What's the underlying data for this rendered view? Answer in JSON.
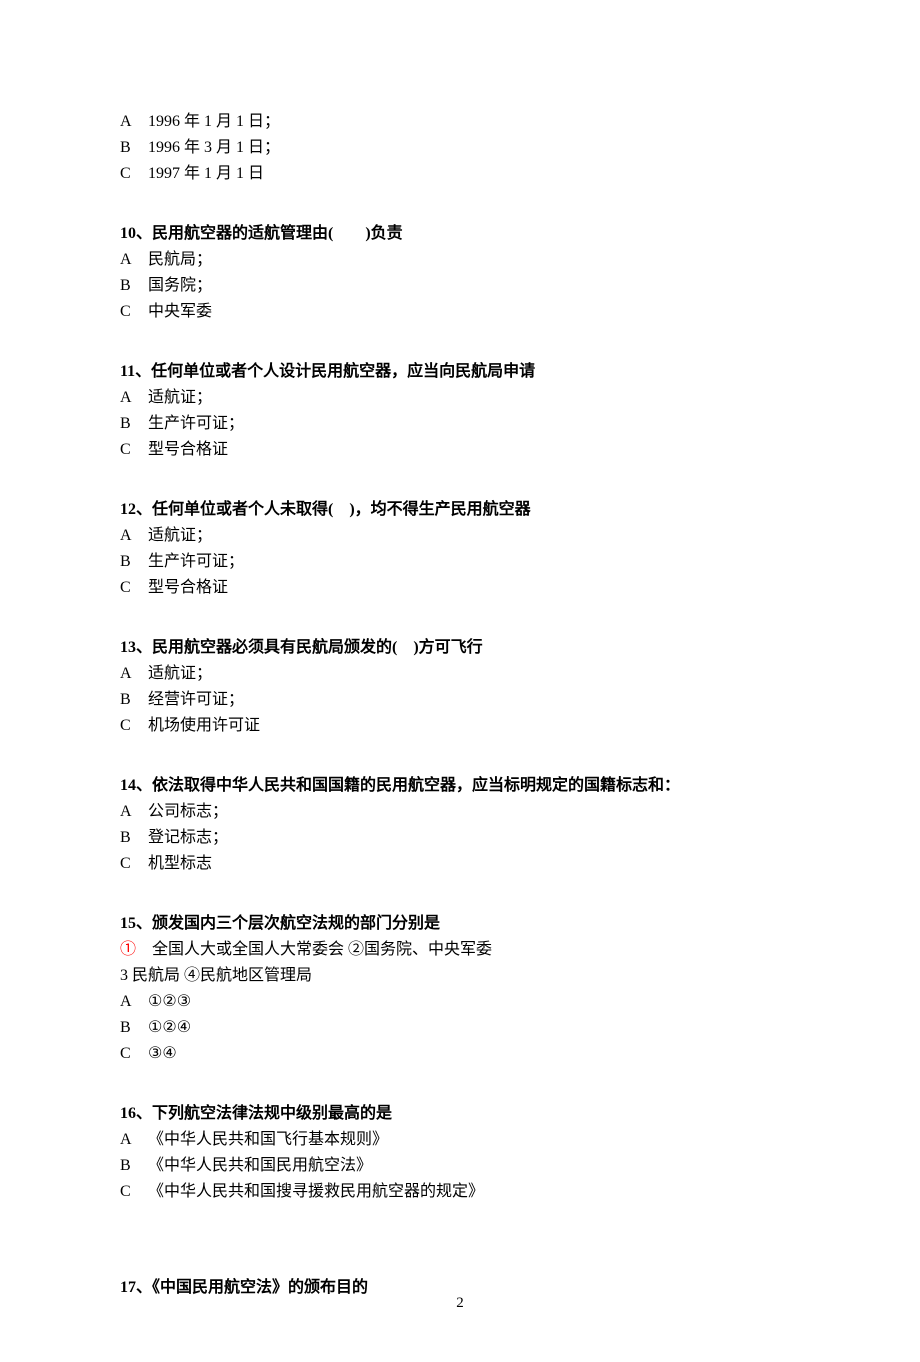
{
  "q9_options": [
    {
      "label": "A",
      "text": "1996 年 1 月 1 日；"
    },
    {
      "label": "B",
      "text": "1996 年 3 月 1 日；"
    },
    {
      "label": "C",
      "text": "1997 年 1 月 1 日"
    }
  ],
  "q10": {
    "stem": "10、民用航空器的适航管理由(　　)负责",
    "options": [
      {
        "label": "A",
        "text": "民航局；"
      },
      {
        "label": "B",
        "text": "国务院；"
      },
      {
        "label": "C",
        "text": "中央军委"
      }
    ]
  },
  "q11": {
    "stem": "11、任何单位或者个人设计民用航空器，应当向民航局申请",
    "options": [
      {
        "label": "A",
        "text": "适航证；"
      },
      {
        "label": "B",
        "text": "生产许可证；"
      },
      {
        "label": "C",
        "text": "型号合格证"
      }
    ]
  },
  "q12": {
    "stem": "12、任何单位或者个人未取得(　)，均不得生产民用航空器",
    "options": [
      {
        "label": "A",
        "text": "适航证；"
      },
      {
        "label": "B",
        "text": "生产许可证；"
      },
      {
        "label": "C",
        "text": "型号合格证"
      }
    ]
  },
  "q13": {
    "stem": "13、民用航空器必须具有民航局颁发的(　)方可飞行",
    "options": [
      {
        "label": "A",
        "text": "适航证；"
      },
      {
        "label": "B",
        "text": "经营许可证；"
      },
      {
        "label": "C",
        "text": "机场使用许可证"
      }
    ]
  },
  "q14": {
    "stem": "14、依法取得中华人民共和国国籍的民用航空器，应当标明规定的国籍标志和：",
    "options": [
      {
        "label": "A",
        "text": "公司标志；"
      },
      {
        "label": "B",
        "text": "登记标志；"
      },
      {
        "label": "C",
        "text": "机型标志"
      }
    ]
  },
  "q15": {
    "stem": "15、颁发国内三个层次航空法规的部门分别是",
    "sub1_prefix": "①",
    "sub1_rest": "　全国人大或全国人大常委会 ②国务院、中央军委",
    "sub2": "3 民航局 ④民航地区管理局",
    "options": [
      {
        "label": "A",
        "text": "①②③"
      },
      {
        "label": "B",
        "text": "①②④"
      },
      {
        "label": "C",
        "text": "③④"
      }
    ]
  },
  "q16": {
    "stem": "16、下列航空法律法规中级别最高的是",
    "options": [
      {
        "label": "A",
        "text": "《中华人民共和国飞行基本规则》"
      },
      {
        "label": "B",
        "text": "《中华人民共和国民用航空法》"
      },
      {
        "label": "C",
        "text": "《中华人民共和国搜寻援救民用航空器的规定》"
      }
    ]
  },
  "q17": {
    "stem": "17、《中国民用航空法》的颁布目的"
  },
  "page_number": "2"
}
